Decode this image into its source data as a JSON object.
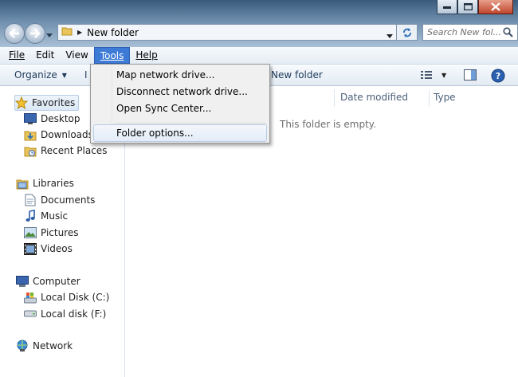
{
  "address": {
    "crumb": "New folder",
    "search_placeholder": "Search New fol..."
  },
  "menu": {
    "items": [
      "File",
      "Edit",
      "View",
      "Tools",
      "Help"
    ],
    "active": "Tools"
  },
  "toolbar": {
    "organize": "Organize",
    "fragment": "I",
    "new_folder": "New folder"
  },
  "tools_menu": {
    "items": [
      "Map network drive...",
      "Disconnect network drive...",
      "Open Sync Center...",
      "Folder options..."
    ],
    "hovered": "Folder options..."
  },
  "sidebar": {
    "favorites": {
      "label": "Favorites",
      "items": [
        "Desktop",
        "Downloads",
        "Recent Places"
      ]
    },
    "libraries": {
      "label": "Libraries",
      "items": [
        "Documents",
        "Music",
        "Pictures",
        "Videos"
      ]
    },
    "computer": {
      "label": "Computer",
      "items": [
        "Local Disk (C:)",
        "Local disk (F:)"
      ]
    },
    "network": {
      "label": "Network"
    }
  },
  "columns": [
    "Date modified",
    "Type"
  ],
  "empty_message": "This folder is empty.",
  "colors": {
    "menu_active": "#3d7bd6",
    "title_gradient_top": "#3a5a7c",
    "hover_border": "#b6cbe6"
  }
}
